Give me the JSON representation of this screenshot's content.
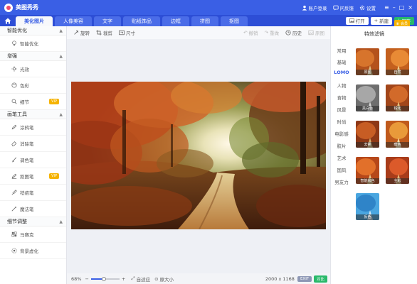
{
  "app": {
    "title": "美图秀秀",
    "account": "账户登录",
    "feedback": "问反馈",
    "settings": "设置"
  },
  "nav": {
    "tabs": [
      "美化图片",
      "人像美容",
      "文字",
      "贴纸饰品",
      "边框",
      "拼图",
      "抠图"
    ],
    "active_tab": "美化图片",
    "open": "打开",
    "new": "新建",
    "vip": "会员",
    "save": "保存"
  },
  "sidebar": {
    "sections": [
      {
        "title": "智能优化",
        "items": [
          {
            "label": "智能优化",
            "icon": "bulb-icon"
          }
        ]
      },
      {
        "title": "增强",
        "items": [
          {
            "label": "光效",
            "icon": "sun-icon"
          },
          {
            "label": "色彩",
            "icon": "palette-icon"
          },
          {
            "label": "细节",
            "icon": "magnify-icon",
            "badge": "VIP"
          }
        ]
      },
      {
        "title": "画笔工具",
        "items": [
          {
            "label": "涂鸦笔",
            "icon": "pen-icon"
          },
          {
            "label": "消除笔",
            "icon": "eraser-icon"
          },
          {
            "label": "调色笔",
            "icon": "brush-icon"
          },
          {
            "label": "抠图笔",
            "icon": "pencil-icon",
            "badge": "VIP"
          },
          {
            "label": "祛痘笔",
            "icon": "dropper-icon"
          },
          {
            "label": "魔法笔",
            "icon": "wand-icon"
          }
        ]
      },
      {
        "title": "细节调整",
        "items": [
          {
            "label": "马赛克",
            "icon": "mosaic-icon"
          },
          {
            "label": "背景虚化",
            "icon": "blur-icon"
          }
        ]
      }
    ]
  },
  "toolbar": {
    "rotate": "旋转",
    "crop": "裁剪",
    "size": "尺寸",
    "undo": "撤销",
    "redo": "重做",
    "history": "历史",
    "reset": "原图"
  },
  "status": {
    "zoom": "68%",
    "zoom_level": 0.45,
    "fit": "自适应",
    "actual": "原大小",
    "dimensions": "2000 x 1168",
    "exif": "EXIF",
    "compare": "对比"
  },
  "filters": {
    "title": "特效滤镜",
    "categories": [
      "常用",
      "基础",
      "LOMO",
      "人物",
      "食物",
      "风景",
      "时尚",
      "电影感",
      "胶片",
      "艺术",
      "国风",
      "男友力"
    ],
    "active_category": "LOMO",
    "items": [
      "原图",
      "自然",
      "黑白色",
      "锐化",
      "去雾",
      "暖色",
      "智能绘色",
      "全彩",
      "反色"
    ]
  },
  "colors": {
    "brand": "#3a5fe5",
    "nav": "#2d4ed6",
    "vip": "#f5b300",
    "save": "#29b96a"
  }
}
